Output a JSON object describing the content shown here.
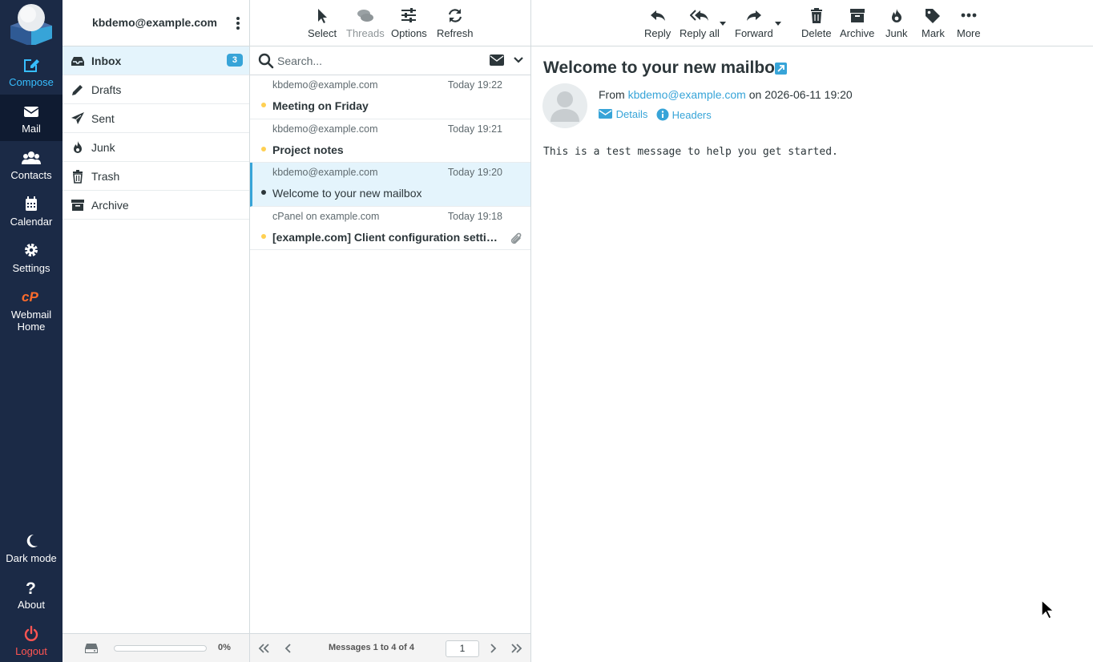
{
  "nav": {
    "items": [
      {
        "label": "Compose",
        "icon": "compose-icon"
      },
      {
        "label": "Mail",
        "icon": "mail-icon"
      },
      {
        "label": "Contacts",
        "icon": "contacts-icon"
      },
      {
        "label": "Calendar",
        "icon": "calendar-icon"
      },
      {
        "label": "Settings",
        "icon": "settings-icon"
      },
      {
        "label": "Webmail Home",
        "icon": "cpanel-icon"
      }
    ],
    "bottom": [
      {
        "label": "Dark mode",
        "icon": "moon-icon"
      },
      {
        "label": "About",
        "icon": "question-icon"
      },
      {
        "label": "Logout",
        "icon": "power-icon"
      }
    ]
  },
  "folders": {
    "account": "kbdemo@example.com",
    "items": [
      {
        "label": "Inbox",
        "badge": "3",
        "icon": "inbox-icon"
      },
      {
        "label": "Drafts",
        "icon": "pencil-icon"
      },
      {
        "label": "Sent",
        "icon": "paper-plane-icon"
      },
      {
        "label": "Junk",
        "icon": "fire-icon"
      },
      {
        "label": "Trash",
        "icon": "trash-icon"
      },
      {
        "label": "Archive",
        "icon": "archive-icon"
      }
    ],
    "quota_percent": "0%"
  },
  "list_toolbar": {
    "select": "Select",
    "threads": "Threads",
    "options": "Options",
    "refresh": "Refresh"
  },
  "search": {
    "placeholder": "Search..."
  },
  "messages": [
    {
      "from": "kbdemo@example.com",
      "date": "Today 19:22",
      "subject": "Meeting on Friday",
      "unread": true
    },
    {
      "from": "kbdemo@example.com",
      "date": "Today 19:21",
      "subject": "Project notes",
      "unread": true
    },
    {
      "from": "kbdemo@example.com",
      "date": "Today 19:20",
      "subject": "Welcome to your new mailbox",
      "unread": false,
      "selected": true
    },
    {
      "from": "cPanel on example.com",
      "date": "Today 19:18",
      "subject": "[example.com] Client configuration settings for “kbdemo@example.com”.",
      "unread": true,
      "attachment": true
    }
  ],
  "pager": {
    "count": "Messages 1 to 4 of 4",
    "page": "1"
  },
  "content_toolbar": {
    "reply": "Reply",
    "reply_all": "Reply all",
    "forward": "Forward",
    "delete": "Delete",
    "archive": "Archive",
    "junk": "Junk",
    "mark": "Mark",
    "more": "More"
  },
  "message": {
    "subject": "Welcome to your new mailbox",
    "from_prefix": "From",
    "from": "kbdemo@example.com",
    "date_prefix": "on",
    "date": "2026-06-11 19:20",
    "details": "Details",
    "headers": "Headers",
    "body": "This is a test message to help you get started."
  },
  "colors": {
    "nav_bg": "#1b2a46",
    "accent": "#37a4d8",
    "compose": "#37beff",
    "logout": "#ff5552",
    "selection": "#e4f4fc",
    "unread_dot": "#ffd052"
  }
}
